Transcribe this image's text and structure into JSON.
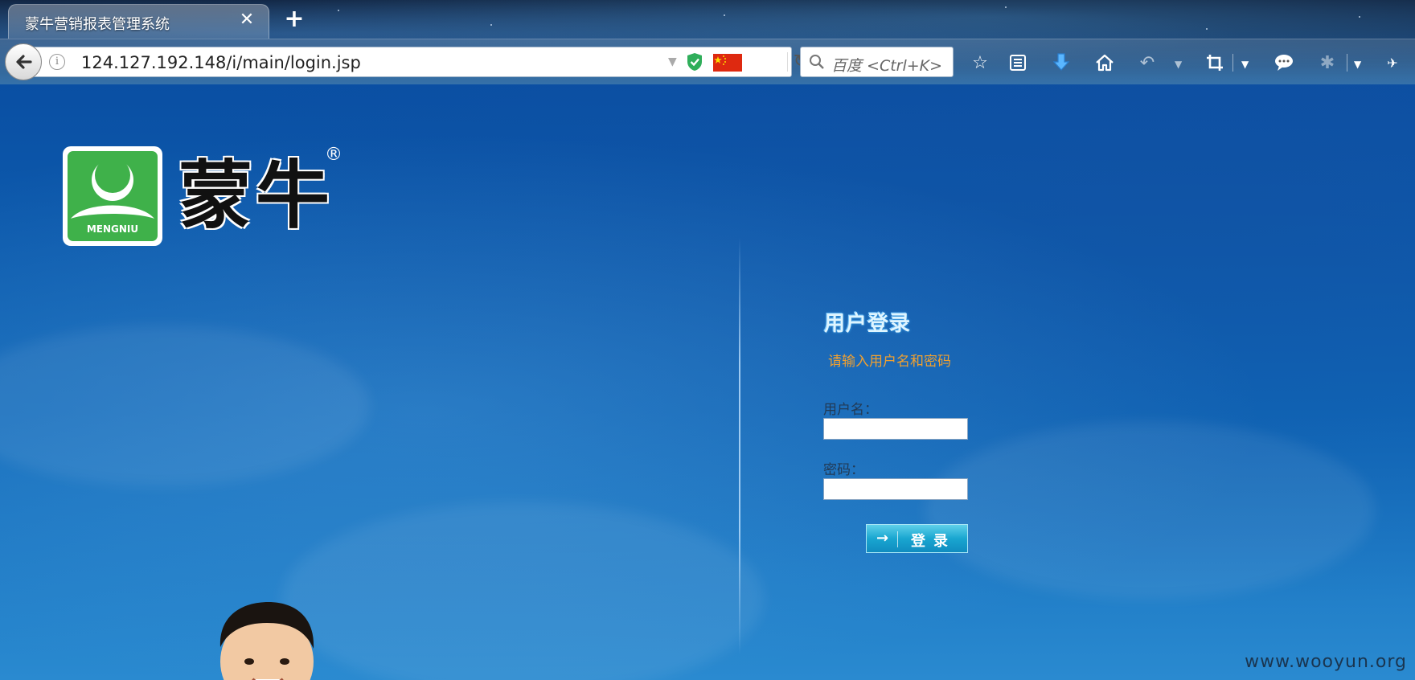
{
  "browser": {
    "tab_title": "蒙牛营销报表管理系统",
    "url": "124.127.192.148/i/main/login.jsp",
    "search_placeholder": "百度 <Ctrl+K>",
    "icons": [
      "back-icon",
      "info-icon",
      "shield-icon",
      "china-flag-icon",
      "reload-icon",
      "search-icon",
      "bookmark-star-icon",
      "reading-list-icon",
      "download-icon",
      "home-icon",
      "undo-icon",
      "crop-icon",
      "chat-icon",
      "extension-icon",
      "menu-icon"
    ]
  },
  "brand": {
    "logo_text": "MENGNIU",
    "name": "蒙牛",
    "registered": "®",
    "green": "#3fb14a"
  },
  "login": {
    "title": "用户登录",
    "hint": "请输入用户名和密码",
    "username_label": "用户名：",
    "username_value": "",
    "password_label": "密码：",
    "password_value": "",
    "submit_arrow": "→",
    "submit_label": "登录"
  },
  "watermark": "www.wooyun.org",
  "colors": {
    "hint": "#f0a030",
    "button": "#19a6d0",
    "sky": "#0f67b8"
  }
}
